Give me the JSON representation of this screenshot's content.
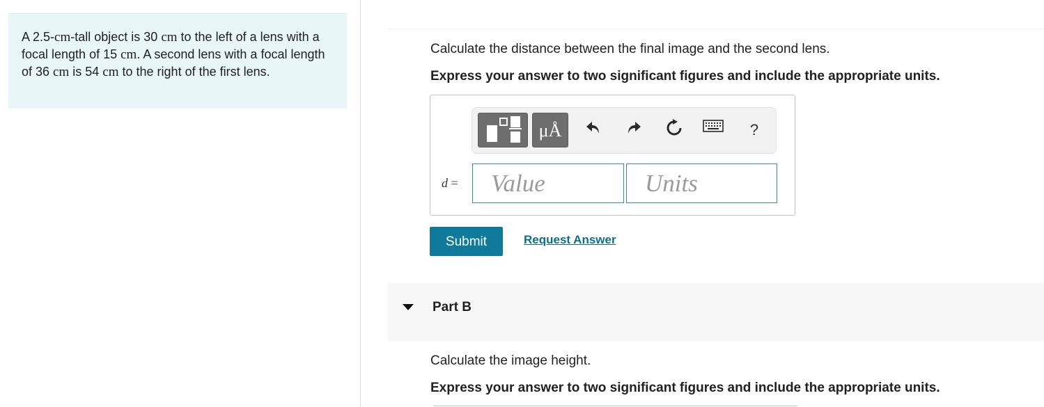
{
  "problem": {
    "seg1": "A 2.5-",
    "unit1": "cm",
    "seg2": "-tall object is 30 ",
    "unit2": "cm",
    "seg3": " to the left of a lens with a focal length of 15 ",
    "unit3": "cm",
    "seg4": ". A second lens with a focal length of 36 ",
    "unit4": "cm",
    "seg5": " is 54 ",
    "unit5": "cm",
    "seg6": " to the right of the first lens."
  },
  "partA": {
    "question": "Calculate the distance between the final image and the second lens.",
    "instruction": "Express your answer to two significant figures and include the appropriate units.",
    "variable": "d",
    "equals": " =",
    "value_placeholder": "Value",
    "units_placeholder": "Units",
    "toolbar": {
      "units_label": "μÅ",
      "help_label": "?",
      "icons": [
        "fraction-template-icon",
        "units-icon",
        "undo-icon",
        "redo-icon",
        "reset-icon",
        "keyboard-icon",
        "help-icon"
      ]
    },
    "submit_label": "Submit",
    "request_answer_label": "Request Answer"
  },
  "partB": {
    "title": "Part B",
    "question": "Calculate the image height.",
    "instruction": "Express your answer to two significant figures and include the appropriate units."
  },
  "colors": {
    "problem_bg": "#e8f6f7",
    "submit_bg": "#0f7a9a",
    "link": "#0d6e8c",
    "input_border": "#3a8c99",
    "toolbar_button": "#6e6e6e"
  }
}
